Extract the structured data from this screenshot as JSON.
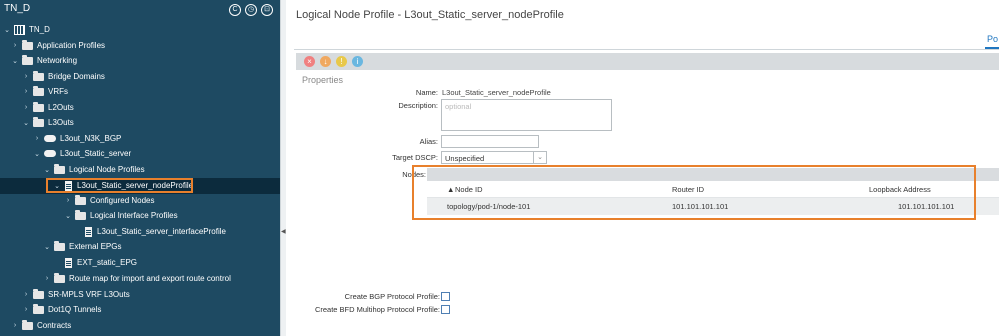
{
  "tree": {
    "title": "TN_D",
    "header_icons": [
      "refresh-icon",
      "history-icon",
      "expand-icon"
    ],
    "items": [
      {
        "label": "TN_D",
        "icon": "tenant-icon",
        "expanded": true
      },
      {
        "label": "Application Profiles",
        "icon": "folder-icon",
        "expanded": false
      },
      {
        "label": "Networking",
        "icon": "folder-icon",
        "expanded": true
      },
      {
        "label": "Bridge Domains",
        "icon": "folder-icon",
        "expanded": false
      },
      {
        "label": "VRFs",
        "icon": "folder-icon",
        "expanded": false
      },
      {
        "label": "L2Outs",
        "icon": "folder-icon",
        "expanded": false
      },
      {
        "label": "L3Outs",
        "icon": "folder-icon",
        "expanded": true
      },
      {
        "label": "L3out_N3K_BGP",
        "icon": "cloud-icon",
        "expanded": false
      },
      {
        "label": "L3out_Static_server",
        "icon": "cloud-icon",
        "expanded": true
      },
      {
        "label": "Logical Node Profiles",
        "icon": "folder-icon",
        "expanded": true
      },
      {
        "label": "L3out_Static_server_nodeProfile",
        "icon": "document-icon",
        "expanded": true,
        "selected": true
      },
      {
        "label": "Configured Nodes",
        "icon": "folder-icon",
        "expanded": false
      },
      {
        "label": "Logical Interface Profiles",
        "icon": "folder-icon",
        "expanded": true
      },
      {
        "label": "L3out_Static_server_interfaceProfile",
        "icon": "document-icon"
      },
      {
        "label": "External EPGs",
        "icon": "folder-icon",
        "expanded": true
      },
      {
        "label": "EXT_static_EPG",
        "icon": "document-icon"
      },
      {
        "label": "Route map for import and export route control",
        "icon": "folder-icon",
        "expanded": false
      },
      {
        "label": "SR-MPLS VRF L3Outs",
        "icon": "folder-icon",
        "expanded": false
      },
      {
        "label": "Dot1Q Tunnels",
        "icon": "folder-icon",
        "expanded": false
      },
      {
        "label": "Contracts",
        "icon": "folder-icon",
        "expanded": false
      }
    ]
  },
  "main": {
    "title": "Logical Node Profile - L3out_Static_server_nodeProfile",
    "tab_label": "Po",
    "properties_label": "Properties",
    "fields": {
      "name_label": "Name:",
      "name_value": "L3out_Static_server_nodeProfile",
      "description_label": "Description:",
      "description_placeholder": "optional",
      "alias_label": "Alias:",
      "alias_value": "",
      "target_dscp_label": "Target DSCP:",
      "target_dscp_value": "Unspecified",
      "nodes_label": "Nodes:"
    },
    "nodes_table": {
      "columns": [
        "Node ID",
        "Router ID",
        "Loopback Address"
      ],
      "sort_indicator": "▲",
      "rows": [
        [
          "topology/pod-1/node-101",
          "101.101.101.101",
          "101.101.101.101"
        ]
      ]
    },
    "create_bgp_label": "Create BGP Protocol Profile:",
    "create_bfd_label": "Create BFD Multihop Protocol Profile:",
    "toolbar_colors": [
      "#f08080",
      "#f0a860",
      "#e8c84a",
      "#6ab7e0"
    ],
    "highlight_color": "#e8802c"
  }
}
